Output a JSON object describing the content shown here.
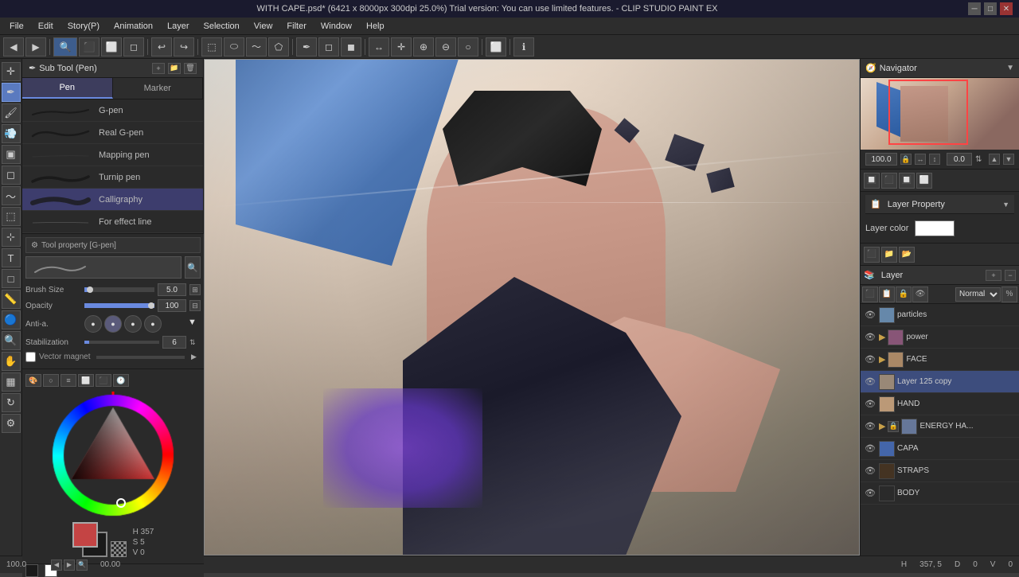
{
  "titlebar": {
    "title": "WITH CAPE.psd* (6421 x 8000px 300dpi 25.0%)  Trial version: You can use limited features. - CLIP STUDIO PAINT EX",
    "minimize": "─",
    "maximize": "□",
    "close": "✕"
  },
  "menubar": {
    "items": [
      "File",
      "Edit",
      "Story(P)",
      "Animation",
      "Layer",
      "Selection",
      "View",
      "Filter",
      "Window",
      "Help"
    ]
  },
  "sub_tool": {
    "header": "Sub Tool (Pen)",
    "tabs": [
      "Pen",
      "Marker"
    ],
    "active_tab": 0,
    "brushes": [
      {
        "name": "G-pen",
        "type": "gpen"
      },
      {
        "name": "Real G-pen",
        "type": "realgpen"
      },
      {
        "name": "Mapping pen",
        "type": "mappingpen"
      },
      {
        "name": "Turnip pen",
        "type": "turnippen"
      },
      {
        "name": "Calligraphy",
        "type": "calligraphy"
      },
      {
        "name": "For effect line",
        "type": "effectline"
      }
    ],
    "active_brush": "G-pen"
  },
  "tool_property": {
    "header": "Tool property [G-pen]",
    "brush_name": "G-pen",
    "brush_size": {
      "label": "Brush Size",
      "value": "5.0",
      "min": 0,
      "max": 100,
      "percent": 5
    },
    "opacity": {
      "label": "Opacity",
      "value": "100",
      "percent": 100
    },
    "anti_alias": {
      "label": "Anti-a.",
      "options": [
        "●",
        "●",
        "●",
        "●"
      ]
    },
    "stabilization": {
      "label": "Stabilization",
      "value": "6",
      "percent": 6
    },
    "vector_magnet": {
      "label": "Vector magnet",
      "enabled": false
    }
  },
  "color_panel": {
    "hue": 357,
    "saturation": 5,
    "brightness": 0,
    "foreground": "#c44444",
    "background": "#1a1a1a",
    "transparent": "#888888"
  },
  "navigator": {
    "title": "Navigator",
    "zoom": "100.0",
    "angle": "0.0"
  },
  "layer_property": {
    "title": "Layer Property",
    "layer_color_label": "Layer color",
    "layer_color": "#ffffff"
  },
  "layers": {
    "title": "Layer",
    "blend_mode": "Normal",
    "items": [
      {
        "name": "particles",
        "visible": true,
        "locked": false,
        "type": "layer",
        "indent": 0
      },
      {
        "name": "power",
        "visible": true,
        "locked": false,
        "type": "folder",
        "indent": 0
      },
      {
        "name": "FACE",
        "visible": true,
        "locked": false,
        "type": "folder",
        "indent": 0
      },
      {
        "name": "Layer 125 copy",
        "visible": true,
        "locked": false,
        "type": "layer",
        "indent": 0
      },
      {
        "name": "HAND",
        "visible": true,
        "locked": false,
        "type": "layer",
        "indent": 0
      },
      {
        "name": "ENERGY HA...",
        "visible": true,
        "locked": false,
        "type": "folder",
        "indent": 0
      },
      {
        "name": "CAPA",
        "visible": true,
        "locked": false,
        "type": "layer",
        "indent": 0
      },
      {
        "name": "STRAPS",
        "visible": true,
        "locked": false,
        "type": "layer",
        "indent": 0
      },
      {
        "name": "BODY",
        "visible": true,
        "locked": false,
        "type": "layer",
        "indent": 0
      }
    ]
  },
  "statusbar": {
    "zoom": "100.0",
    "coords": "357, 5",
    "deg": "0",
    "val": "0"
  },
  "toolbar": {
    "tools": [
      "undo",
      "redo",
      "transform",
      "select-rect",
      "select-lasso",
      "pen",
      "eraser",
      "move",
      "zoom",
      "eyedropper"
    ]
  }
}
